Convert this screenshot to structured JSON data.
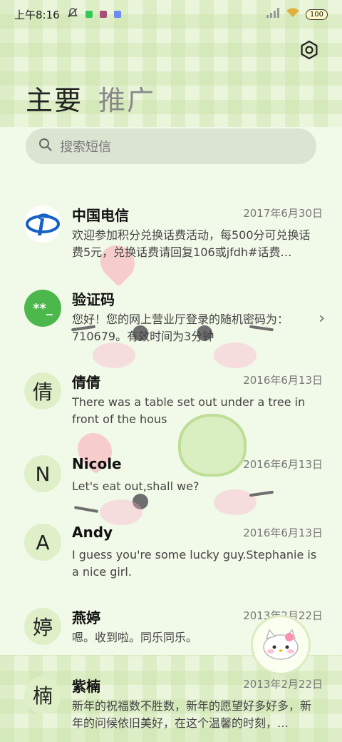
{
  "status_bar": {
    "time": "上午8:16",
    "battery": "100"
  },
  "tabs": [
    {
      "label": "主要",
      "active": true
    },
    {
      "label": "推广",
      "active": false
    }
  ],
  "search": {
    "placeholder": "搜索短信"
  },
  "conversations": [
    {
      "avatar_text": "",
      "avatar_icon": "china-telecom-logo",
      "name": "中国电信",
      "date": "2017年6月30日",
      "preview": "欢迎参加积分兑换话费活动，每500分可兑换话费5元，兑换话费请回复106或jfdh#话费…"
    },
    {
      "avatar_text": "**_",
      "avatar_icon": "",
      "name": "验证码",
      "date": "",
      "preview": "您好！您的网上营业厅登录的随机密码为：710679。有效时间为3分钟",
      "chevron": "›"
    },
    {
      "avatar_text": "倩",
      "avatar_icon": "",
      "name": "倩倩",
      "date": "2016年6月13日",
      "preview": "There was a table set out under a tree in front of the hous"
    },
    {
      "avatar_text": "N",
      "avatar_icon": "",
      "name": "Nicole",
      "date": "2016年6月13日",
      "preview": "Let's eat out,shall we?"
    },
    {
      "avatar_text": "A",
      "avatar_icon": "",
      "name": "Andy",
      "date": "2016年6月13日",
      "preview": "I guess you're some lucky guy.Stephanie is a nice girl."
    },
    {
      "avatar_text": "婷",
      "avatar_icon": "",
      "name": "燕婷",
      "date": "2013年2月22日",
      "preview": "嗯。收到啦。同乐同乐。"
    },
    {
      "avatar_text": "楠",
      "avatar_icon": "",
      "name": "紫楠",
      "date": "2013年2月22日",
      "preview": "新年的祝福数不胜数，新年的愿望好多好多，新年的问候依旧美好，在这个温馨的时刻，…"
    }
  ],
  "colors": {
    "accent_green": "#4cb84c",
    "telecom_blue": "#1561c6"
  }
}
